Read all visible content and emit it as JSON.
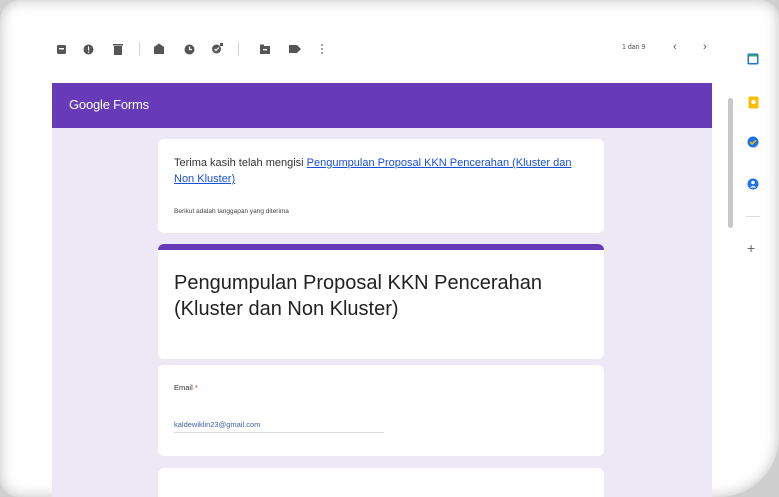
{
  "toolbar": {
    "icons": [
      "archive-icon",
      "report-spam-icon",
      "delete-icon",
      "mark-unread-icon",
      "snooze-icon",
      "add-task-icon",
      "move-to-icon",
      "label-icon",
      "more-icon"
    ],
    "pager_text": "1 dari 9",
    "prev": "‹",
    "next": "›"
  },
  "side_panel": {
    "icons": [
      "calendar-icon",
      "keep-icon",
      "tasks-icon",
      "contacts-icon"
    ],
    "add": "+"
  },
  "gf_header": {
    "title": "Google Forms",
    "color": "#673ab7"
  },
  "thanks": {
    "prefix": "Terima kasih telah mengisi ",
    "link": "Pengumpulan Proposal KKN Pencerahan (Kluster dan Non Kluster)",
    "sub": "Berikut adalah tanggapan yang diterima"
  },
  "form": {
    "title": "Pengumpulan Proposal KKN Pencerahan (Kluster dan Non Kluster)"
  },
  "email_field": {
    "label": "Email",
    "required": "*",
    "value": "kaldewiklin23@gmail.com"
  }
}
